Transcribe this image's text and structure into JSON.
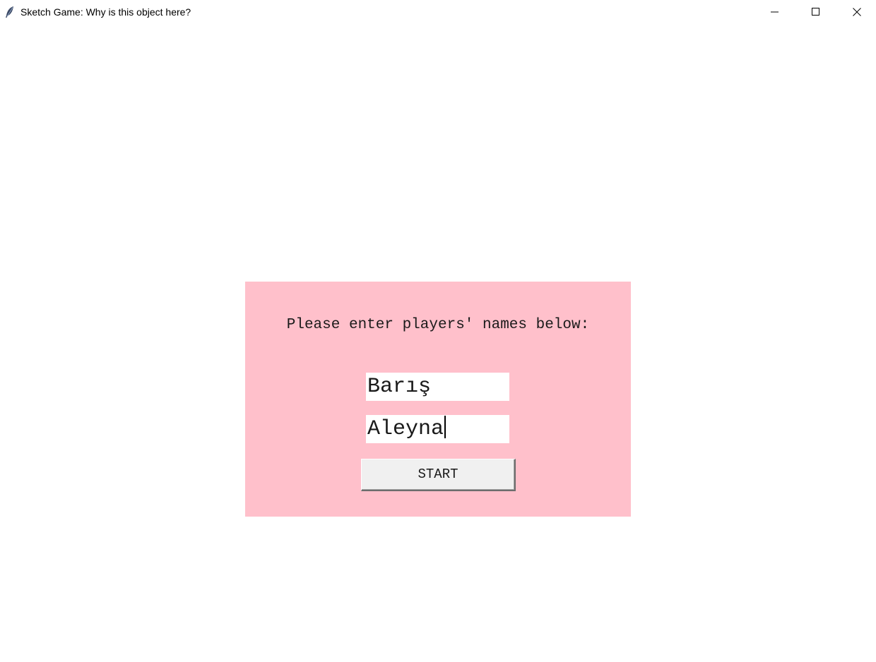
{
  "window": {
    "title": "Sketch Game: Why is this object here?",
    "icon": "feather-icon",
    "controls": [
      "minimize-icon",
      "maximize-icon",
      "close-icon"
    ]
  },
  "form": {
    "prompt": "Please enter players' names below:",
    "player1_value": "Barış",
    "player2_value": "Aleyna",
    "start_label": "START"
  },
  "colors": {
    "panel_background": "#ffc0cb",
    "window_background": "#ffffff",
    "input_background": "#ffffff",
    "button_background": "#f0f0f0"
  }
}
